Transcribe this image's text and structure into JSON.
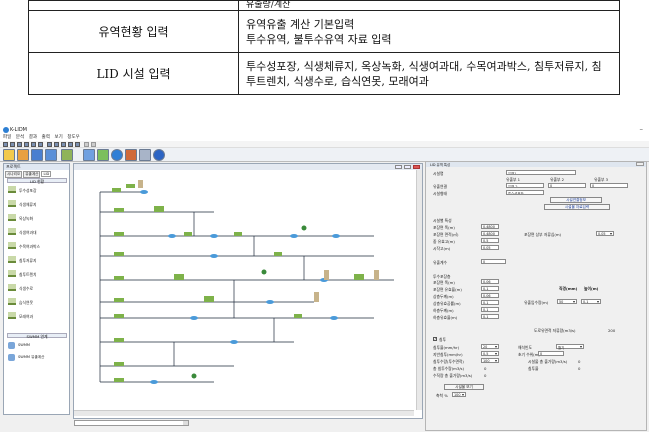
{
  "spec_table": {
    "rows": [
      {
        "label": "",
        "content": [
          "유출량/계산"
        ]
      },
      {
        "label": "유역현황 입력",
        "content": [
          "유역유출 계산 기본입력",
          "투수유역, 불투수유역 자료 입력"
        ]
      },
      {
        "label": "LID 시설 입력",
        "content": [
          "투수성포장, 식생체류지, 옥상녹화, 식생여과대, 수목여과박스, 침투저류지, 침",
          "투트렌치, 식생수로, 습식연못, 모래여과"
        ]
      }
    ]
  },
  "app": {
    "title": "K-LIDM",
    "minimize": "–",
    "menu": [
      "파일",
      "분석",
      "결과",
      "출력",
      "보기",
      "창도우"
    ],
    "left_panel": {
      "title": "프로젝트",
      "tabs": [
        "시나리오",
        "유출계산",
        "LID"
      ],
      "lid_header": "LID 현황",
      "lid_items": [
        "투수성포장",
        "식생체류지",
        "옥상녹화",
        "식생여과대",
        "수목여과박스",
        "침투저류지",
        "침투트렌치",
        "식생수로",
        "습식연못",
        "모래여과"
      ],
      "swmm_header": "SWMM 연계",
      "swmm_items": [
        "SWMM",
        "SWMM 유출계산"
      ]
    },
    "props": {
      "title": "LID 유역 특성",
      "name_label": "시설명",
      "name_value": "유역1",
      "col_headers": [
        "유출부 1",
        "유출부 2",
        "유출부 3"
      ],
      "type_label": "유출연결",
      "type_values": [
        "유역 2",
        "0",
        "0"
      ],
      "type2_label": "시설형태",
      "type2_value": "투수성포장",
      "btn_connect": "시설연결정보",
      "btn_area": "시설물 자료입력",
      "section_label": "시설별 특성",
      "fields": [
        {
          "label": "포장면 폭(m)",
          "value": "0.4800"
        },
        {
          "label": "포장면 면적(㎡)",
          "value": "0.4800"
        },
        {
          "label": "중 유효고(m)",
          "value": "0.5"
        },
        {
          "label": "시작고(m)",
          "value": "0.05"
        }
      ],
      "side_field_label": "포장면 상부 저류심(m)",
      "side_field_value": "0.05",
      "runoff_coef_label": "유출계수",
      "runoff_coef_value": "0",
      "section2_label": "투수포장층",
      "fields2": [
        {
          "label": "포장면 폭(m)",
          "value": "0.06"
        },
        {
          "label": "포장면 유효율(m)",
          "value": "0.1"
        },
        {
          "label": "상층두께(m)",
          "value": "0.06"
        },
        {
          "label": "상층유효공률(m)",
          "value": "0.1"
        },
        {
          "label": "하층두께(m)",
          "value": "0.1"
        },
        {
          "label": "하층유효율(m)",
          "value": "0.1"
        }
      ],
      "width_label": "직경(mm)",
      "height_label": "높이(m)",
      "drain_label": "유출입수량(m)",
      "drain_values": [
        "50",
        "0.1"
      ],
      "check_label": "침투",
      "infil_fields": [
        {
          "label": "침투율(mm/hr)",
          "value": "20"
        },
        {
          "label": "지반침투(mm/hr)",
          "value": "0.5"
        },
        {
          "label": "침투수량(투수면적)",
          "value": "100"
        },
        {
          "label": "총 침투수량(m3/s)",
          "value": "0"
        },
        {
          "label": "수직량 총 출가량(m3/s)",
          "value": "0"
        }
      ],
      "infil_right_label": "도로유면적 저류량(m3/s)",
      "infil_right_value": "200",
      "period_label": "해석빈도",
      "period_value": "월기",
      "extra_labels": [
        "초기 수위(m)",
        "시설물 총 출가량(m3/s)",
        "침투율"
      ],
      "extra_values": [
        "0",
        "0",
        "0"
      ],
      "btn_save": "시설물 보기",
      "scale_label": "축척 %",
      "scale_value": "100"
    }
  }
}
